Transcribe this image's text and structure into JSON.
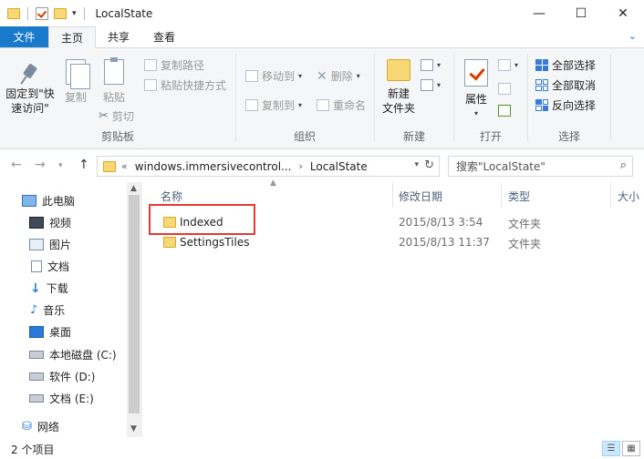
{
  "window": {
    "title": "LocalState",
    "minimize": "—",
    "maximize": "☐",
    "close": "✕"
  },
  "tabs": {
    "file": "文件",
    "home": "主页",
    "share": "共享",
    "view": "查看",
    "chevron": "⌄"
  },
  "ribbon": {
    "clipboard": {
      "label": "剪贴板",
      "pin_line1": "固定到\"快",
      "pin_line2": "速访问\"",
      "copy": "复制",
      "paste": "粘贴",
      "copy_path": "复制路径",
      "paste_shortcut": "粘贴快捷方式",
      "cut": "剪切"
    },
    "organize": {
      "label": "组织",
      "move_to": "移动到",
      "copy_to": "复制到",
      "delete": "删除",
      "rename": "重命名"
    },
    "new": {
      "label": "新建",
      "new_folder_line1": "新建",
      "new_folder_line2": "文件夹"
    },
    "open": {
      "label": "打开",
      "properties": "属性"
    },
    "select": {
      "label": "选择",
      "select_all": "全部选择",
      "select_none": "全部取消",
      "invert": "反向选择"
    }
  },
  "address": {
    "overflow": "«",
    "crumb1": "windows.immersivecontrol...",
    "sep": "›",
    "crumb2": "LocalState",
    "search_placeholder": "搜索\"LocalState\""
  },
  "nav": {
    "this_pc": "此电脑",
    "videos": "视频",
    "pictures": "图片",
    "documents": "文档",
    "downloads": "下载",
    "music": "音乐",
    "desktop": "桌面",
    "local_disk": "本地磁盘 (C:)",
    "software": "软件 (D:)",
    "docs_drive": "文档 (E:)",
    "network": "网络"
  },
  "columns": {
    "name": "名称",
    "modified": "修改日期",
    "type": "类型",
    "size": "大小"
  },
  "files": [
    {
      "name": "Indexed",
      "modified": "2015/8/13 3:54",
      "type": "文件夹"
    },
    {
      "name": "SettingsTiles",
      "modified": "2015/8/13 11:37",
      "type": "文件夹"
    }
  ],
  "status": {
    "count": "2 个项目"
  }
}
